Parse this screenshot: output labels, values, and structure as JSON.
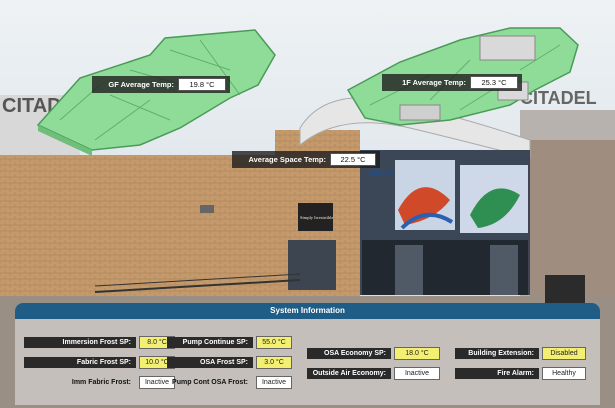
{
  "overlays": {
    "gf_avg_temp": {
      "label": "GF Average Temp:",
      "value": "19.8 °C"
    },
    "f1_avg_temp": {
      "label": "1F Average Temp:",
      "value": "25.3 °C"
    },
    "avg_space_temp": {
      "label": "Average Space Temp:",
      "value": "22.5 °C"
    }
  },
  "signage": {
    "left_sign": "CITAD",
    "right_sign": "CITADEL",
    "entrance_sign": "Citadel",
    "shop_sign": "Simply Irresistible"
  },
  "system_info": {
    "title": "System Information",
    "immersion_frost_sp": {
      "label": "Immersion Frost SP:",
      "value": "8.0 °C"
    },
    "fabric_frost_sp": {
      "label": "Fabric Frost SP:",
      "value": "10.0 °C"
    },
    "imm_fabric_frost": {
      "label": "Imm Fabric Frost:",
      "value": "Inactive"
    },
    "pump_continue_sp": {
      "label": "Pump Continue SP:",
      "value": "55.0 °C"
    },
    "osa_frost_sp": {
      "label": "OSA Frost SP:",
      "value": "3.0 °C"
    },
    "pump_cont_osa_frost": {
      "label": "Pump Cont OSA Frost:",
      "value": "Inactive"
    },
    "osa_economy_sp": {
      "label": "OSA Economy SP:",
      "value": "18.0 °C"
    },
    "outside_air_economy": {
      "label": "Outside Air Economy:",
      "value": "Inactive"
    },
    "building_extension": {
      "label": "Building Extension:",
      "value": "Disabled"
    },
    "fire_alarm": {
      "label": "Fire Alarm:",
      "value": "Healthy"
    }
  },
  "colors": {
    "panel_header": "#1f5d87",
    "setpoint_yellow": "#f3ef72",
    "floorplan_green": "#8fdc98"
  }
}
